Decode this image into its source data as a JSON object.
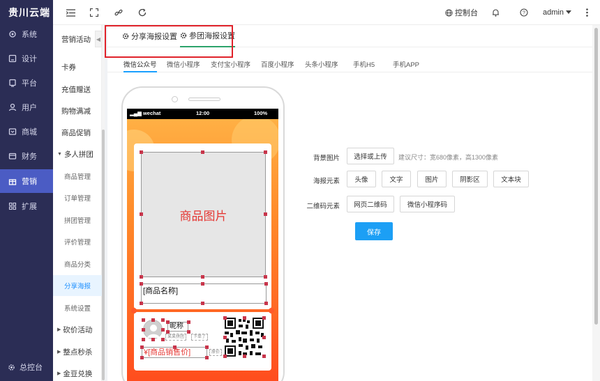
{
  "app": {
    "brand": "贵川云端"
  },
  "sidebar": {
    "items": [
      {
        "label": "系统",
        "icon": "settings-icon"
      },
      {
        "label": "设计",
        "icon": "design-icon"
      },
      {
        "label": "平台",
        "icon": "platform-icon"
      },
      {
        "label": "用户",
        "icon": "user-icon"
      },
      {
        "label": "商城",
        "icon": "store-icon"
      },
      {
        "label": "财务",
        "icon": "finance-icon"
      },
      {
        "label": "营销",
        "icon": "gift-icon",
        "active": true
      },
      {
        "label": "扩展",
        "icon": "grid-icon"
      }
    ],
    "footer": "总控台"
  },
  "header": {
    "console": "控制台",
    "user": "admin"
  },
  "subnav": {
    "title": "营销活动",
    "items": [
      {
        "label": "卡券"
      },
      {
        "label": "充值赠送"
      },
      {
        "label": "购物满减"
      },
      {
        "label": "商品促销"
      },
      {
        "label": "多人拼团",
        "expanded": true
      },
      {
        "label": "商品管理"
      },
      {
        "label": "订单管理"
      },
      {
        "label": "拼团管理"
      },
      {
        "label": "评价管理"
      },
      {
        "label": "商品分类"
      },
      {
        "label": "分享海报",
        "active": true
      },
      {
        "label": "系统设置"
      },
      {
        "label": "砍价活动"
      },
      {
        "label": "整点秒杀"
      },
      {
        "label": "金豆兑换"
      }
    ]
  },
  "page_tabs": [
    {
      "label": "分享海报设置"
    },
    {
      "label": "参团海报设置",
      "active": true
    }
  ],
  "channel_tabs": [
    {
      "label": "微信公众号",
      "active": true
    },
    {
      "label": "微信小程序"
    },
    {
      "label": "支付宝小程序"
    },
    {
      "label": "百度小程序"
    },
    {
      "label": "头条小程序"
    },
    {
      "label": "手机H5"
    },
    {
      "label": "手机APP"
    }
  ],
  "phone": {
    "carrier": "wechat",
    "time": "12:00",
    "battery": "100%",
    "product_image": "商品图片",
    "product_name": "[商品名称]",
    "nickname": "昵称",
    "tag1": "某某拼团",
    "tag2": "下单了",
    "price": "¥[商品销售价]",
    "original_price": "原价"
  },
  "settings": {
    "bg_label": "背景图片",
    "bg_button": "选择或上传",
    "bg_hint": "建议尺寸：宽680像素，高1300像素",
    "elements_label": "海报元素",
    "elements": [
      "头像",
      "文字",
      "图片",
      "阴影区",
      "文本块"
    ],
    "qr_label": "二维码元素",
    "qr_buttons": [
      "网页二维码",
      "微信小程序码"
    ],
    "save": "保存"
  },
  "colors": {
    "sidebar_bg": "#2b2d55",
    "sidebar_active": "#4b5cc4",
    "accent_blue": "#1c9ff5",
    "tab_underline_green": "#2ca36b",
    "highlight_red": "#e0222a"
  }
}
